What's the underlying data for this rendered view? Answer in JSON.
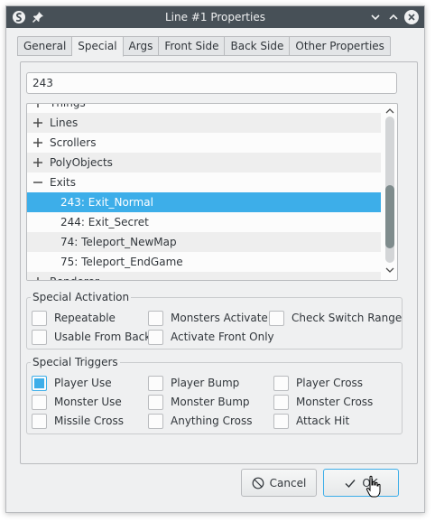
{
  "window": {
    "title": "Line #1 Properties",
    "icons": [
      "app-icon",
      "pin-icon",
      "minimize-icon",
      "maximize-icon",
      "close-icon"
    ]
  },
  "tabs": [
    {
      "label": "General"
    },
    {
      "label": "Special",
      "active": true
    },
    {
      "label": "Args"
    },
    {
      "label": "Front Side"
    },
    {
      "label": "Back Side"
    },
    {
      "label": "Other Properties"
    }
  ],
  "filter": {
    "value": "243"
  },
  "tree": {
    "rows": [
      {
        "label": "Things",
        "expander": "collapsed"
      },
      {
        "label": "Lines",
        "expander": "collapsed"
      },
      {
        "label": "Scrollers",
        "expander": "collapsed"
      },
      {
        "label": "PolyObjects",
        "expander": "collapsed"
      },
      {
        "label": "Exits",
        "expander": "expanded"
      },
      {
        "label": "243: Exit_Normal",
        "child": true,
        "selected": true
      },
      {
        "label": "244: Exit_Secret",
        "child": true
      },
      {
        "label": "74: Teleport_NewMap",
        "child": true
      },
      {
        "label": "75: Teleport_EndGame",
        "child": true
      },
      {
        "label": "Renderer",
        "expander": "collapsed"
      }
    ]
  },
  "activation": {
    "title": "Special Activation",
    "options": [
      {
        "label": "Repeatable",
        "checked": false
      },
      {
        "label": "Monsters Activate",
        "checked": false
      },
      {
        "label": "Check Switch Range",
        "checked": false
      },
      {
        "label": "Usable From Back",
        "checked": false
      },
      {
        "label": "Activate Front Only",
        "checked": false
      }
    ]
  },
  "triggers": {
    "title": "Special Triggers",
    "options": [
      {
        "label": "Player Use",
        "checked": false,
        "hover": true
      },
      {
        "label": "Player Bump",
        "checked": false
      },
      {
        "label": "Player Cross",
        "checked": false
      },
      {
        "label": "Monster Use",
        "checked": false
      },
      {
        "label": "Monster Bump",
        "checked": false
      },
      {
        "label": "Monster Cross",
        "checked": false
      },
      {
        "label": "Missile Cross",
        "checked": false
      },
      {
        "label": "Anything Cross",
        "checked": false
      },
      {
        "label": "Attack Hit",
        "checked": false
      }
    ]
  },
  "buttons": {
    "cancel": "Cancel",
    "ok": "OK"
  },
  "colors": {
    "accent": "#3daee9",
    "titlebar": "#475057",
    "window_bg": "#eff0f1"
  }
}
